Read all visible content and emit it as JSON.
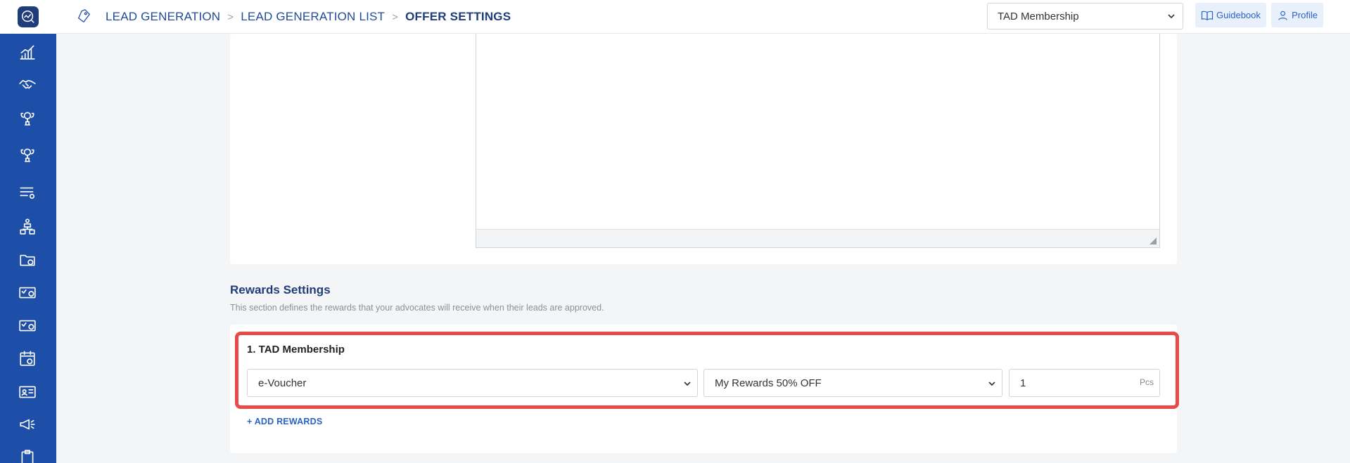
{
  "header": {
    "breadcrumb": [
      "LEAD GENERATION",
      "LEAD GENERATION LIST",
      "OFFER SETTINGS"
    ],
    "breadcrumb_separator": ">",
    "membership_select": "TAD Membership",
    "guidebook_label": "Guidebook",
    "profile_label": "Profile"
  },
  "sidebar": {
    "icons": [
      "analytics-icon",
      "handshake-icon",
      "trophy-icon",
      "trophy-alt-icon",
      "list-settings-icon",
      "hierarchy-icon",
      "folder-settings-icon",
      "card-settings-icon",
      "card-settings-alt-icon",
      "calendar-settings-icon",
      "id-card-icon",
      "megaphone-icon",
      "clipboard-icon"
    ]
  },
  "rewards": {
    "title": "Rewards Settings",
    "description": "This section defines the rewards that your advocates will receive when their leads are approved.",
    "item_title": "1. TAD Membership",
    "type_value": "e-Voucher",
    "reward_value": "My Rewards 50% OFF",
    "quantity_value": "1",
    "quantity_unit": "Pcs",
    "add_label": "+ ADD REWARDS"
  },
  "colors": {
    "sidebar": "#1e4fa8",
    "accent": "#2b63c2",
    "highlight": "#e84a4a"
  }
}
